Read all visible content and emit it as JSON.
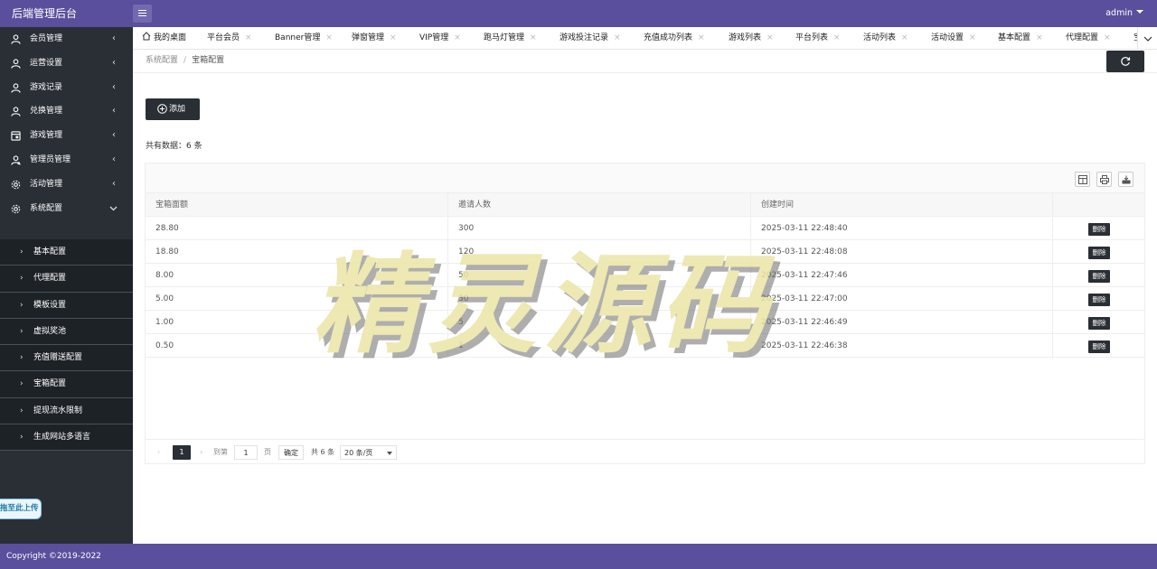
{
  "app": {
    "title": "后端管理后台",
    "user": "admin"
  },
  "sidebar": {
    "items": [
      {
        "label": "会员管理",
        "icon": "user-icon"
      },
      {
        "label": "运营设置",
        "icon": "user-icon"
      },
      {
        "label": "游戏记录",
        "icon": "user-icon"
      },
      {
        "label": "兑换管理",
        "icon": "user-icon"
      },
      {
        "label": "游戏管理",
        "icon": "doc-icon"
      },
      {
        "label": "管理员管理",
        "icon": "admin-icon"
      },
      {
        "label": "活动管理",
        "icon": "gear-icon"
      },
      {
        "label": "系统配置",
        "icon": "gear-icon"
      }
    ],
    "subitems": [
      "基本配置",
      "代理配置",
      "模板设置",
      "虚拟奖池",
      "充值赠送配置",
      "宝箱配置",
      "提现流水限制",
      "生成网站多语言"
    ],
    "upload_label": "拖至此上传"
  },
  "tabs": [
    "我的桌面",
    "平台会员",
    "Banner管理",
    "弹窗管理",
    "VIP管理",
    "跑马灯管理",
    "游戏投注记录",
    "充值成功列表",
    "游戏列表",
    "平台列表",
    "活动列表",
    "活动设置",
    "基本配置",
    "代理配置",
    "宝"
  ],
  "breadcrumb": {
    "parent": "系统配置",
    "current": "宝箱配置"
  },
  "toolbar": {
    "add_label": "添加",
    "count_text": "共有数据：6 条"
  },
  "table": {
    "columns": [
      "宝箱面额",
      "邀请人数",
      "创建时间",
      ""
    ],
    "rows": [
      {
        "amount": "28.80",
        "invites": "300",
        "created": "2025-03-11 22:48:40"
      },
      {
        "amount": "18.80",
        "invites": "120",
        "created": "2025-03-11 22:48:08"
      },
      {
        "amount": "8.00",
        "invites": "50",
        "created": "2025-03-11 22:47:46"
      },
      {
        "amount": "5.00",
        "invites": "30",
        "created": "2025-03-11 22:47:00"
      },
      {
        "amount": "1.00",
        "invites": "5",
        "created": "2025-03-11 22:46:49"
      },
      {
        "amount": "0.50",
        "invites": "1",
        "created": "2025-03-11 22:46:38"
      }
    ],
    "delete_label": "删除"
  },
  "pager": {
    "current": "1",
    "goto_label": "到第",
    "page_input": "1",
    "page_unit": "页",
    "confirm": "确定",
    "total": "共 6 条",
    "per_page": "20 条/页"
  },
  "watermark": "精灵源码",
  "footer": "Copyright ©2019-2022",
  "colors": {
    "header": "#5a4f9c",
    "sidebar": "#2a2f36",
    "button": "#2a2f36"
  }
}
